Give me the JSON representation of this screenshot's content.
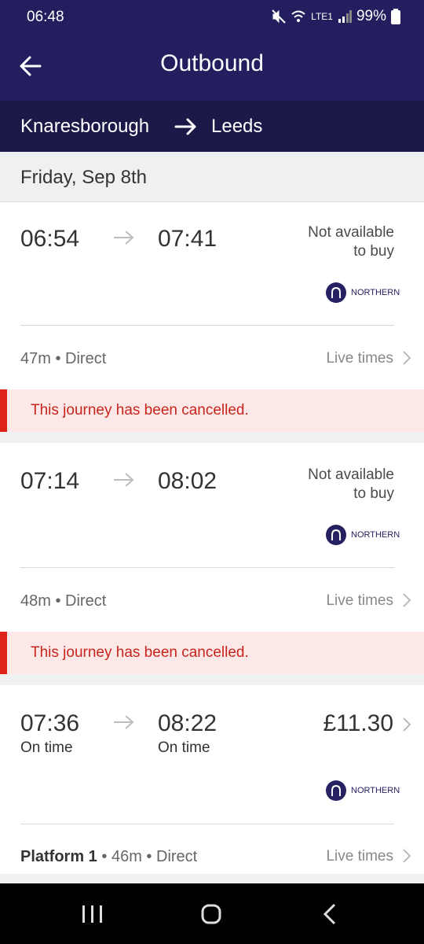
{
  "status_bar": {
    "time": "06:48",
    "battery": "99%",
    "network": "LTE1",
    "icons": [
      "mute-icon",
      "wifi-icon",
      "signal-icon",
      "battery-icon"
    ]
  },
  "header": {
    "title": "Outbound",
    "back_icon": "arrow-left-icon"
  },
  "route": {
    "from": "Knaresborough",
    "to": "Leeds"
  },
  "date": "Friday, Sep 8th",
  "journeys": [
    {
      "depart": "06:54",
      "arrive": "07:41",
      "availability": [
        "Not available",
        "to buy"
      ],
      "operator": "NORTHERN",
      "duration": "47m",
      "type": "Direct",
      "live_label": "Live times",
      "alert": "This journey has been cancelled."
    },
    {
      "depart": "07:14",
      "arrive": "08:02",
      "availability": [
        "Not available",
        "to buy"
      ],
      "operator": "NORTHERN",
      "duration": "48m",
      "type": "Direct",
      "live_label": "Live times",
      "alert": "This journey has been cancelled."
    },
    {
      "depart": "07:36",
      "arrive": "08:22",
      "depart_status": "On time",
      "arrive_status": "On time",
      "price": "£11.30",
      "operator": "NORTHERN",
      "platform": "Platform 1",
      "duration": "46m",
      "type": "Direct",
      "live_label": "Live times"
    }
  ],
  "separator": "•",
  "colors": {
    "header": "#231f5e",
    "route_bar": "#1c1848",
    "alert_bar": "#dd2317",
    "alert_bg": "#fde8e8",
    "operator": "#262262"
  }
}
